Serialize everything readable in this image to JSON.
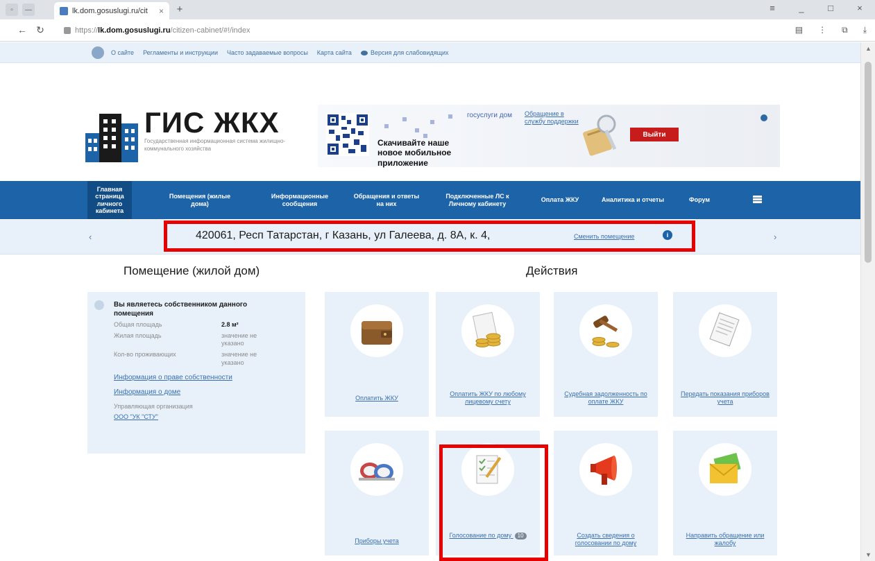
{
  "browser": {
    "tab_title": "lk.dom.gosuslugi.ru/cit",
    "tab_close": "×",
    "new_tab": "+",
    "url_prefix": "https://",
    "url_host": "lk.dom.gosuslugi.ru",
    "url_path": "/citizen-cabinet/#!/index",
    "window": {
      "minimize": "_",
      "maximize": "□",
      "close": "×",
      "menu": "≡"
    }
  },
  "toplinks": [
    "О сайте",
    "Регламенты и инструкции",
    "Часто задаваемые вопросы",
    "Карта сайта",
    "Версия для слабовидящих"
  ],
  "header": {
    "title": "ГИС ЖКХ",
    "subtitle": "Государственная информационная система жилищно-коммунального хозяйства",
    "gosuslugi_label": "госуслуги дом",
    "app_text": "Скачивайте наше новое мобильное приложение",
    "support_link": "Обращение в службу поддержки",
    "logout_label": "Выйти"
  },
  "mainnav": [
    "Главная страница личного кабинета",
    "Помещения (жилые дома)",
    "Информационные сообщения",
    "Обращения и ответы на них",
    "Подключенные ЛС к Личному кабинету",
    "Оплата ЖКУ",
    "Аналитика и отчеты",
    "Форум"
  ],
  "address": {
    "text": "420061, Респ Татарстан, г Казань, ул Галеева, д. 8А, к. 4,",
    "change_link": "Сменить помещение",
    "prev": "‹",
    "next": "›",
    "info": "i"
  },
  "premises": {
    "title": "Помещение (жилой дом)",
    "owner_text": "Вы являетесь собственником данного помещения",
    "total_area_label": "Общая площадь",
    "total_area_value": "2.8 м²",
    "living_area_label": "Жилая площадь",
    "living_area_value": "значение не указано",
    "residents_label": "Кол-во проживающих",
    "residents_value": "значение не указано",
    "ownership_link": "Информация о праве собственности",
    "house_link": "Информация о доме",
    "org_label": "Управляющая организация",
    "org_value": "ООО \"УК \"СТУ\""
  },
  "actions": {
    "title": "Действия",
    "tiles": [
      {
        "label": "Оплатить ЖКУ",
        "icon": "wallet-icon"
      },
      {
        "label": "Оплатить ЖКУ по любому лицевому счету",
        "icon": "coins-invoice-icon"
      },
      {
        "label": "Судебная задолженность по оплате ЖКУ",
        "icon": "gavel-icon"
      },
      {
        "label": "Передать показания приборов учета",
        "icon": "document-icon"
      },
      {
        "label": "Приборы учета",
        "icon": "water-meter-icon"
      },
      {
        "label": "Голосование по дому",
        "icon": "voting-icon",
        "badge": "10"
      },
      {
        "label": "Создать сведения о голосовании по дому",
        "icon": "megaphone-icon"
      },
      {
        "label": "Направить обращение или жалобу",
        "icon": "envelope-icon"
      }
    ]
  }
}
